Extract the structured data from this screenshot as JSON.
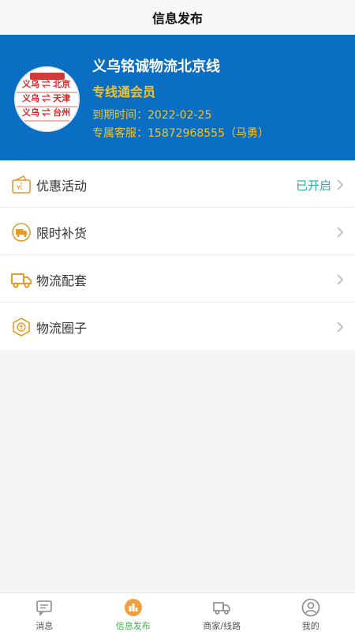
{
  "navbar": {
    "title": "信息发布"
  },
  "profile": {
    "avatar_lines": [
      "浙江铭诚",
      "义乌 ⇌ 北京",
      "义乌 ⇌ 天津",
      "义乌 ⇌ 台州"
    ],
    "company": "义乌铭诚物流北京线",
    "member_level": "专线通会员",
    "expire": "到期时间：2022-02-25",
    "service": "专属客服：15872968555（马勇）"
  },
  "menu": {
    "items": [
      {
        "label": "优惠活动",
        "status": "已开启",
        "icon": "coupon-icon"
      },
      {
        "label": "限时补货",
        "status": "",
        "icon": "restock-icon"
      },
      {
        "label": "物流配套",
        "status": "",
        "icon": "truck-icon"
      },
      {
        "label": "物流圈子",
        "status": "",
        "icon": "circle-icon"
      }
    ]
  },
  "tabbar": {
    "items": [
      {
        "label": "消息",
        "icon": "message-icon"
      },
      {
        "label": "信息发布",
        "icon": "publish-icon",
        "active": true
      },
      {
        "label": "商家/线路",
        "icon": "delivery-icon"
      },
      {
        "label": "我的",
        "icon": "user-icon"
      }
    ]
  },
  "colors": {
    "brand_blue": "#0a6fc2",
    "member_gold": "#f3c22b",
    "status_teal": "#2aa9a0",
    "active_tab": "#3cae4a",
    "icon_orange": "#e49a2b"
  }
}
